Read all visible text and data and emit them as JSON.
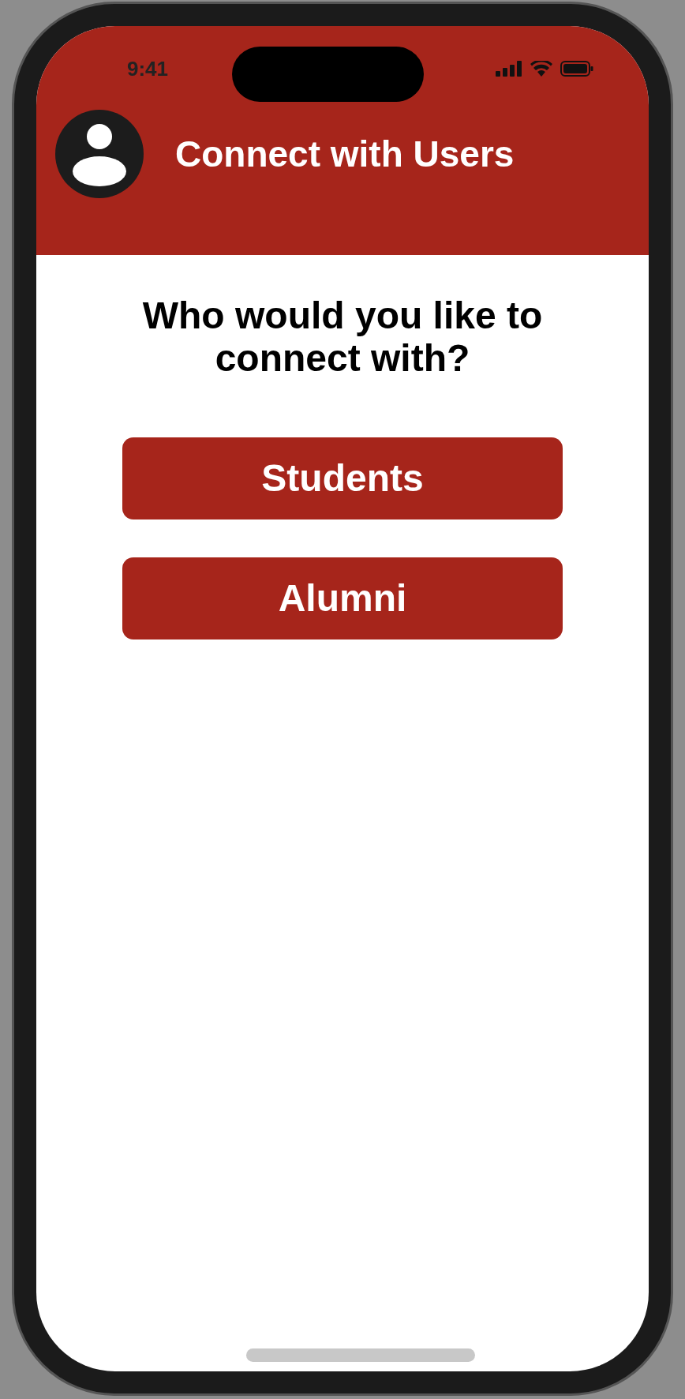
{
  "status_bar": {
    "time": "9:41"
  },
  "header": {
    "title": "Connect with Users"
  },
  "prompt": "Who would you like to connect with?",
  "buttons": [
    {
      "label": "Students"
    },
    {
      "label": "Alumni"
    }
  ]
}
